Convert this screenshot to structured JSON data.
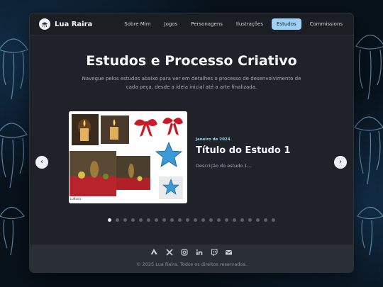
{
  "brand": {
    "name": "Lua Raira"
  },
  "nav": {
    "items": [
      "Sobre Mim",
      "Jogos",
      "Personagens",
      "Ilustrações",
      "Estudos",
      "Commissions"
    ],
    "active": "Estudos"
  },
  "hero": {
    "title": "Estudos e Processo Criativo",
    "subtitle": "Navegue pelos estudos abaixo para ver em detalhes o processo de desenvolvimento de cada peça, desde a ideia inicial até a arte finalizada."
  },
  "slide": {
    "date": "Janeiro de 2024",
    "title": "Título do Estudo 1",
    "description": "Descrição do estudo 1...",
    "signature": "LuRaira"
  },
  "carousel": {
    "prev_label": "‹",
    "next_label": "›",
    "total_slides": 22,
    "active_index": 0
  },
  "footer": {
    "icons": [
      "artstation-icon",
      "x-icon",
      "instagram-icon",
      "linkedin-icon",
      "twitch-icon",
      "email-icon"
    ],
    "copyright": "© 2025 Lua Raira. Todos os direitos reservados."
  },
  "colors": {
    "accent": "#9ed1f5",
    "window_bg": "#1f2228",
    "footer_bg": "#2a2e35"
  }
}
